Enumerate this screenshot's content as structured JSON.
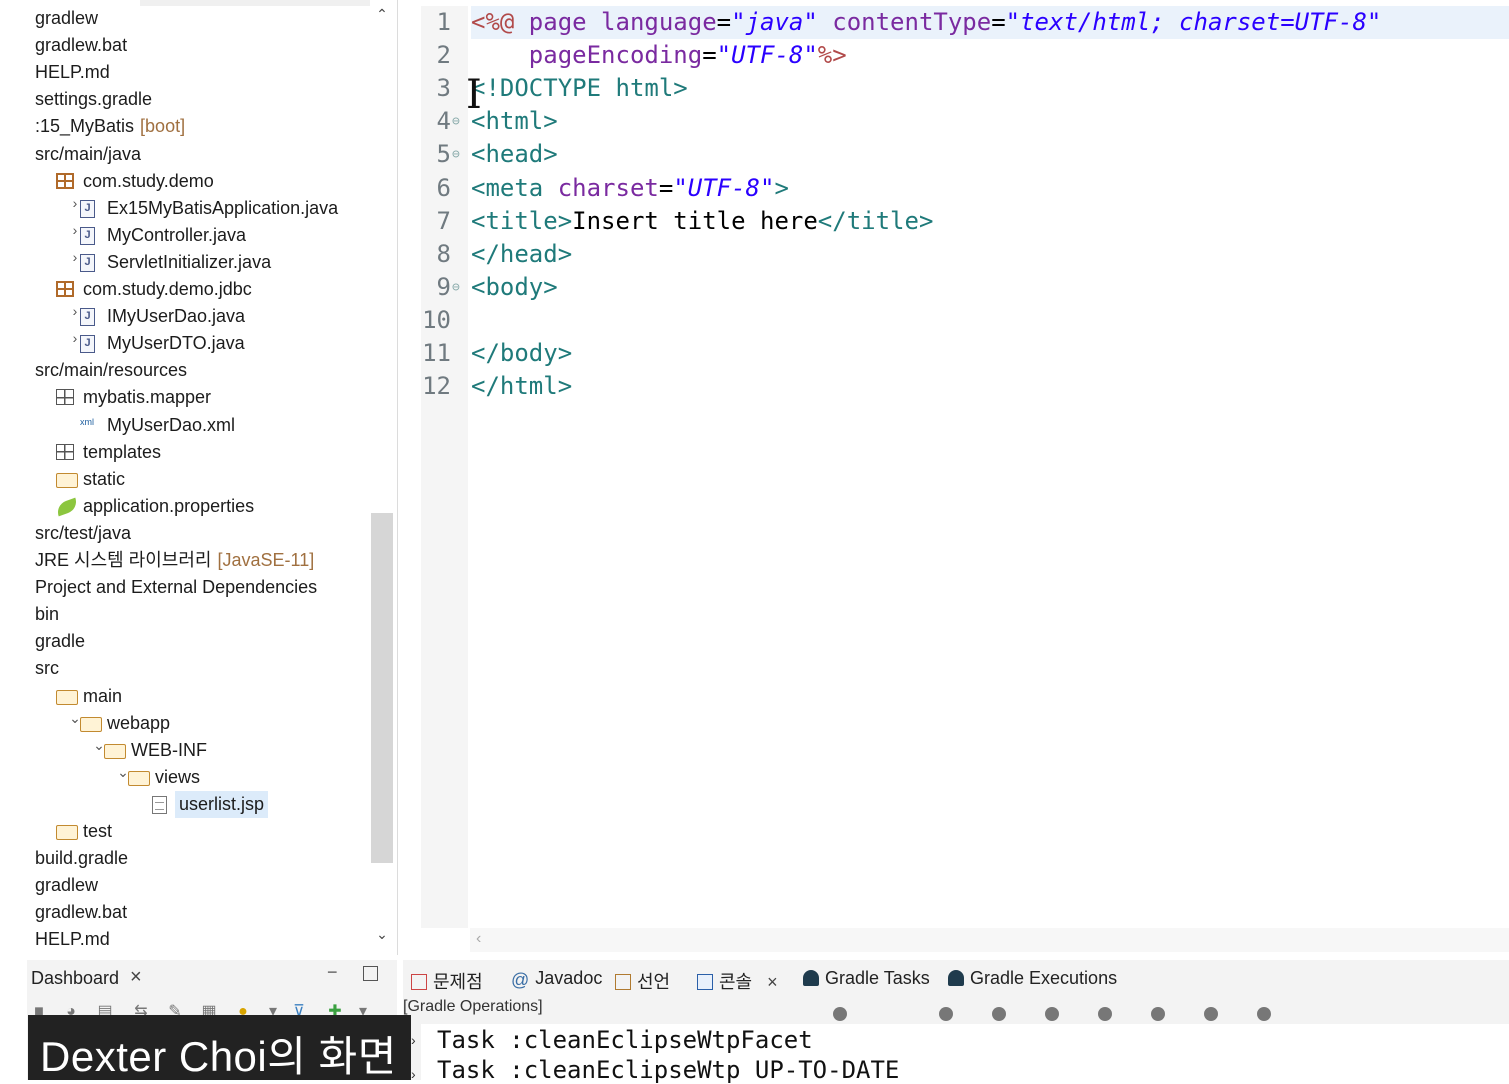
{
  "explorer": {
    "items": [
      {
        "label": "gradlew",
        "icon": "none",
        "indent": 0
      },
      {
        "label": "gradlew.bat",
        "icon": "none",
        "indent": 0
      },
      {
        "label": "HELP.md",
        "icon": "none",
        "indent": 0
      },
      {
        "label": "settings.gradle",
        "icon": "none",
        "indent": 0
      },
      {
        "label": ":15_MyBatis",
        "decor": "[boot]",
        "icon": "none",
        "indent": 0
      },
      {
        "label": "src/main/java",
        "icon": "none",
        "indent": 0
      },
      {
        "label": "com.study.demo",
        "icon": "package",
        "indent": 1
      },
      {
        "label": "Ex15MyBatisApplication.java",
        "icon": "java",
        "indent": 2,
        "chevron": ">"
      },
      {
        "label": "MyController.java",
        "icon": "java",
        "indent": 2,
        "chevron": ">"
      },
      {
        "label": "ServletInitializer.java",
        "icon": "java",
        "indent": 2,
        "chevron": ">"
      },
      {
        "label": "com.study.demo.jdbc",
        "icon": "package",
        "indent": 1
      },
      {
        "label": "IMyUserDao.java",
        "icon": "java",
        "indent": 2,
        "chevron": ">"
      },
      {
        "label": "MyUserDTO.java",
        "icon": "java",
        "indent": 2,
        "chevron": ">"
      },
      {
        "label": "src/main/resources",
        "icon": "none",
        "indent": 0
      },
      {
        "label": "mybatis.mapper",
        "icon": "package-empty",
        "indent": 1
      },
      {
        "label": "MyUserDao.xml",
        "icon": "xml",
        "indent": 2
      },
      {
        "label": "templates",
        "icon": "package-empty",
        "indent": 1
      },
      {
        "label": "static",
        "icon": "folder",
        "indent": 1
      },
      {
        "label": "application.properties",
        "icon": "leaf",
        "indent": 1
      },
      {
        "label": "src/test/java",
        "icon": "none",
        "indent": 0
      },
      {
        "label": "JRE 시스템 라이브러리",
        "decor": "[JavaSE-11]",
        "icon": "none",
        "indent": 0
      },
      {
        "label": "Project and External Dependencies",
        "icon": "none",
        "indent": 0
      },
      {
        "label": "bin",
        "icon": "none",
        "indent": 0
      },
      {
        "label": "gradle",
        "icon": "none",
        "indent": 0
      },
      {
        "label": "src",
        "icon": "none",
        "indent": 0
      },
      {
        "label": "main",
        "icon": "folder",
        "indent": 1
      },
      {
        "label": "webapp",
        "icon": "folder",
        "indent": 2,
        "chevron": "v"
      },
      {
        "label": "WEB-INF",
        "icon": "folder",
        "indent": 3,
        "chevron": "v"
      },
      {
        "label": "views",
        "icon": "folder",
        "indent": 4,
        "chevron": "v"
      },
      {
        "label": "userlist.jsp",
        "icon": "file",
        "indent": 5,
        "selected": true
      },
      {
        "label": "test",
        "icon": "folder",
        "indent": 1
      },
      {
        "label": "build.gradle",
        "icon": "none",
        "indent": 0
      },
      {
        "label": "gradlew",
        "icon": "none",
        "indent": 0
      },
      {
        "label": "gradlew.bat",
        "icon": "none",
        "indent": 0
      },
      {
        "label": "HELP.md",
        "icon": "none",
        "indent": 0
      }
    ]
  },
  "editor": {
    "lines": [
      {
        "n": "1",
        "fold": false,
        "tokens": [
          [
            "dir",
            "<%@ "
          ],
          [
            "attr",
            "page "
          ],
          [
            "attr",
            "language"
          ],
          [
            "txt",
            "="
          ],
          [
            "str",
            "\"java\" "
          ],
          [
            "attr",
            "contentType"
          ],
          [
            "txt",
            "="
          ],
          [
            "str",
            "\"text/html; charset=UTF-8\""
          ]
        ]
      },
      {
        "n": "2",
        "fold": false,
        "tokens": [
          [
            "txt",
            "    "
          ],
          [
            "attr",
            "pageEncoding"
          ],
          [
            "txt",
            "="
          ],
          [
            "str",
            "\"UTF-8\""
          ],
          [
            "dir",
            "%>"
          ]
        ]
      },
      {
        "n": "3",
        "fold": false,
        "tokens": [
          [
            "tag",
            "<!DOCTYPE "
          ],
          [
            "tag",
            "html>"
          ]
        ]
      },
      {
        "n": "4",
        "fold": true,
        "tokens": [
          [
            "tag",
            "<html>"
          ]
        ]
      },
      {
        "n": "5",
        "fold": true,
        "tokens": [
          [
            "tag",
            "<head>"
          ]
        ]
      },
      {
        "n": "6",
        "fold": false,
        "tokens": [
          [
            "tag",
            "<meta "
          ],
          [
            "attr",
            "charset"
          ],
          [
            "txt",
            "="
          ],
          [
            "str",
            "\"UTF-8\""
          ],
          [
            "tag",
            ">"
          ]
        ]
      },
      {
        "n": "7",
        "fold": false,
        "tokens": [
          [
            "tag",
            "<title>"
          ],
          [
            "txt",
            "Insert title here"
          ],
          [
            "tag",
            "</title>"
          ]
        ]
      },
      {
        "n": "8",
        "fold": false,
        "tokens": [
          [
            "tag",
            "</head>"
          ]
        ]
      },
      {
        "n": "9",
        "fold": true,
        "tokens": [
          [
            "tag",
            "<body>"
          ]
        ]
      },
      {
        "n": "10",
        "fold": false,
        "tokens": []
      },
      {
        "n": "11",
        "fold": false,
        "tokens": [
          [
            "tag",
            "</body>"
          ]
        ]
      },
      {
        "n": "12",
        "fold": false,
        "tokens": [
          [
            "tag",
            "</html>"
          ]
        ]
      }
    ],
    "cursor_glyph": "I"
  },
  "dashboard": {
    "title": "Dashboard",
    "close": "×",
    "minimize": "▭"
  },
  "console": {
    "tabs": [
      {
        "label": "문제점",
        "icon": "problems-icon"
      },
      {
        "label": "Javadoc",
        "icon": "javadoc-icon"
      },
      {
        "label": "선언",
        "icon": "declaration-icon"
      },
      {
        "label": "콘솔",
        "icon": "console-icon",
        "close": "×"
      },
      {
        "label": "Gradle Tasks",
        "icon": "gradle-tasks-icon"
      },
      {
        "label": "Gradle Executions",
        "icon": "gradle-executions-icon"
      }
    ],
    "operations_label": "[Gradle Operations]",
    "output": [
      "Task :cleanEclipseWtpFacet",
      "Task :cleanEclipseWtp UP-TO-DATE"
    ]
  },
  "watermark": "Dexter Choi의 화면",
  "colors": {
    "tag": "#1f7a7a",
    "attr": "#7a2aa0",
    "string": "#2a00ff",
    "directive": "#b14a4a",
    "selection": "#dcebfa"
  }
}
